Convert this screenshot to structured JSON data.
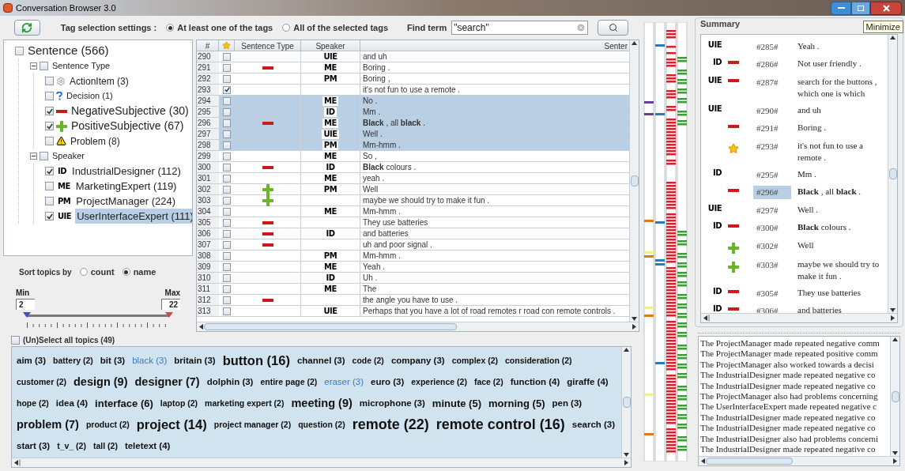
{
  "window": {
    "title": "Conversation Browser 3.0",
    "tooltip": "Minimize"
  },
  "toolbar": {
    "label": "Tag selection settings :",
    "options": [
      {
        "label": "At least one of the tags",
        "selected": true
      },
      {
        "label": "All of the selected tags",
        "selected": false
      }
    ],
    "find_label": "Find term",
    "find_value": "\"search\""
  },
  "tree": {
    "label": "Sentence (566)",
    "checked": false,
    "children": [
      {
        "label": "Sentence Type",
        "checked": false,
        "expanded": true,
        "kind": "none",
        "children": [
          {
            "label": "ActionItem (3)",
            "checked": false,
            "kind": "gear",
            "selected": false
          },
          {
            "label": "Decision (1)",
            "checked": false,
            "kind": "question",
            "selected": false
          },
          {
            "label": "NegativeSubjective (30)",
            "checked": true,
            "kind": "negative",
            "selected": false
          },
          {
            "label": "PositiveSubjective (67)",
            "checked": true,
            "kind": "positive",
            "selected": false
          },
          {
            "label": "Problem (8)",
            "checked": false,
            "kind": "warning",
            "selected": false
          }
        ]
      },
      {
        "label": "Speaker",
        "checked": false,
        "expanded": true,
        "kind": "none",
        "children": [
          {
            "label": "IndustrialDesigner (112)",
            "checked": true,
            "kind": "speaker",
            "code": "ID",
            "selected": false
          },
          {
            "label": "MarketingExpert (119)",
            "checked": false,
            "kind": "speaker",
            "code": "ME",
            "selected": false
          },
          {
            "label": "ProjectManager (224)",
            "checked": false,
            "kind": "speaker",
            "code": "PM",
            "selected": false
          },
          {
            "label": "UserInterfaceExpert (111)",
            "checked": true,
            "kind": "speaker",
            "code": "UIE",
            "selected": true
          }
        ]
      }
    ]
  },
  "sort": {
    "label": "Sort topics by",
    "options": [
      {
        "label": "count",
        "selected": false
      },
      {
        "label": "name",
        "selected": true
      }
    ]
  },
  "range": {
    "min_label": "Min",
    "max_label": "Max",
    "min_value": "2",
    "max_value": "22",
    "thumbs": [
      {
        "level": 0
      },
      {
        "level": 1
      }
    ]
  },
  "table": {
    "columns": [
      "#",
      "Sentence Type",
      "Speaker",
      "Senter"
    ],
    "rows": [
      {
        "number": "290",
        "starred": false,
        "kind": "none",
        "speaker": "UIE",
        "text": "and uh",
        "selected": false
      },
      {
        "number": "291",
        "starred": false,
        "kind": "negative",
        "speaker": "ME",
        "text": "Boring .",
        "selected": false
      },
      {
        "number": "292",
        "starred": false,
        "kind": "none",
        "speaker": "PM",
        "text": "Boring ,",
        "selected": false
      },
      {
        "number": "293",
        "starred": true,
        "kind": "none",
        "text": "it's not fun to use a remote .",
        "selected": false
      },
      {
        "number": "294",
        "starred": false,
        "kind": "none",
        "speaker": "ME",
        "text": "No .",
        "selected": true
      },
      {
        "number": "295",
        "starred": false,
        "kind": "none",
        "speaker": "ID",
        "text": "Mm .",
        "selected": true
      },
      {
        "number": "296",
        "starred": false,
        "kind": "negative",
        "speaker": "ME",
        "text": "**Black** , all **black** .",
        "selected": true
      },
      {
        "number": "297",
        "starred": false,
        "kind": "none",
        "speaker": "UIE",
        "text": "Well .",
        "selected": true
      },
      {
        "number": "298",
        "starred": false,
        "kind": "none",
        "speaker": "PM",
        "text": "Mm-hmm .",
        "selected": true
      },
      {
        "number": "299",
        "starred": false,
        "kind": "none",
        "speaker": "ME",
        "text": "So ,",
        "selected": false
      },
      {
        "number": "300",
        "starred": false,
        "kind": "negative",
        "speaker": "ID",
        "text": "**Black** colours .",
        "selected": false
      },
      {
        "number": "301",
        "starred": false,
        "kind": "none",
        "speaker": "ME",
        "text": "yeah .",
        "selected": false
      },
      {
        "number": "302",
        "starred": false,
        "kind": "positive",
        "speaker": "PM",
        "text": "Well",
        "selected": false
      },
      {
        "number": "303",
        "starred": false,
        "kind": "positive",
        "text": "maybe we should try to make it fun .",
        "selected": false
      },
      {
        "number": "304",
        "starred": false,
        "kind": "none",
        "speaker": "ME",
        "text": "Mm-hmm .",
        "selected": false
      },
      {
        "number": "305",
        "starred": false,
        "kind": "negative",
        "text": "They use batteries",
        "selected": false
      },
      {
        "number": "306",
        "starred": false,
        "kind": "negative",
        "speaker": "ID",
        "text": "and batteries",
        "selected": false
      },
      {
        "number": "307",
        "starred": false,
        "kind": "negative",
        "text": "uh and poor signal .",
        "selected": false
      },
      {
        "number": "308",
        "starred": false,
        "kind": "none",
        "speaker": "PM",
        "text": "Mm-hmm .",
        "selected": false
      },
      {
        "number": "309",
        "starred": false,
        "kind": "none",
        "speaker": "ME",
        "text": "Yeah .",
        "selected": false
      },
      {
        "number": "310",
        "starred": false,
        "kind": "none",
        "speaker": "ID",
        "text": "Uh .",
        "selected": false
      },
      {
        "number": "311",
        "starred": false,
        "kind": "none",
        "speaker": "ME",
        "text": "The",
        "selected": false
      },
      {
        "number": "312",
        "starred": false,
        "kind": "negative",
        "text": "the angle you have to use .",
        "selected": false
      },
      {
        "number": "313",
        "starred": false,
        "kind": "none",
        "speaker": "UIE",
        "text": "Perhaps that you have a lot of road remotes r road con remote controls .",
        "selected": false
      }
    ]
  },
  "topics": {
    "select_all": {
      "label": "(Un)Select all topics (49)",
      "checked": false
    },
    "items": [
      {
        "label": "aim (3)",
        "kind": "s",
        "selected": false
      },
      {
        "label": "battery (2)",
        "kind": "xs",
        "selected": false
      },
      {
        "label": "bit (3)",
        "kind": "s",
        "selected": false
      },
      {
        "label": "black (3)",
        "kind": "s",
        "selected": true
      },
      {
        "label": "britain (3)",
        "kind": "s",
        "selected": false
      },
      {
        "label": "button (16)",
        "kind": "xl",
        "selected": false
      },
      {
        "label": "channel (3)",
        "kind": "s",
        "selected": false
      },
      {
        "label": "code (2)",
        "kind": "xs",
        "selected": false
      },
      {
        "label": "company (3)",
        "kind": "s",
        "selected": false
      },
      {
        "label": "complex (2)",
        "kind": "xs",
        "selected": false
      },
      {
        "label": "consideration (2)",
        "kind": "xs",
        "selected": false
      },
      {
        "label": "customer (2)",
        "kind": "xs",
        "selected": false
      },
      {
        "label": "design (9)",
        "kind": "l",
        "selected": false
      },
      {
        "label": "designer (7)",
        "kind": "l",
        "selected": false
      },
      {
        "label": "dolphin (3)",
        "kind": "s",
        "selected": false
      },
      {
        "label": "entire page (2)",
        "kind": "xs",
        "selected": false
      },
      {
        "label": "eraser (3)",
        "kind": "s",
        "selected": true
      },
      {
        "label": "euro (3)",
        "kind": "s",
        "selected": false
      },
      {
        "label": "experience (2)",
        "kind": "xs",
        "selected": false
      },
      {
        "label": "face (2)",
        "kind": "xs",
        "selected": false
      },
      {
        "label": "function (4)",
        "kind": "s",
        "selected": false
      },
      {
        "label": "giraffe (4)",
        "kind": "s",
        "selected": false
      },
      {
        "label": "hope (2)",
        "kind": "xs",
        "selected": false
      },
      {
        "label": "idea (4)",
        "kind": "s",
        "selected": false
      },
      {
        "label": "interface (6)",
        "kind": "m",
        "selected": false
      },
      {
        "label": "laptop (2)",
        "kind": "xs",
        "selected": false
      },
      {
        "label": "marketing expert (2)",
        "kind": "xs",
        "selected": false
      },
      {
        "label": "meeting (9)",
        "kind": "l",
        "selected": false
      },
      {
        "label": "microphone (3)",
        "kind": "s",
        "selected": false
      },
      {
        "label": "minute (5)",
        "kind": "m",
        "selected": false
      },
      {
        "label": "morning (5)",
        "kind": "m",
        "selected": false
      },
      {
        "label": "pen (3)",
        "kind": "s",
        "selected": false
      },
      {
        "label": "problem (7)",
        "kind": "l",
        "selected": false
      },
      {
        "label": "product (2)",
        "kind": "xs",
        "selected": false
      },
      {
        "label": "project (14)",
        "kind": "xl",
        "selected": false
      },
      {
        "label": "project manager (2)",
        "kind": "xs",
        "selected": false
      },
      {
        "label": "question (2)",
        "kind": "xs",
        "selected": false
      },
      {
        "label": "remote (22)",
        "kind": "xxl",
        "selected": false
      },
      {
        "label": "remote control (16)",
        "kind": "xxl",
        "selected": false
      },
      {
        "label": "search (3)",
        "kind": "s",
        "selected": false
      },
      {
        "label": "start (3)",
        "kind": "s",
        "selected": false
      },
      {
        "label": "t_v_ (2)",
        "kind": "xs",
        "selected": false
      },
      {
        "label": "tall (2)",
        "kind": "xs",
        "selected": false
      },
      {
        "label": "teletext (4)",
        "kind": "s",
        "selected": false
      }
    ]
  },
  "summary": {
    "title": "Summary",
    "rows": [
      {
        "speaker": "UIE",
        "kind": "none",
        "number": "#285#",
        "text": "Yeah .",
        "selected": false
      },
      {
        "speaker": "ID",
        "kind": "negative",
        "number": "#286#",
        "text": "Not user friendly .",
        "selected": false
      },
      {
        "speaker": "UIE",
        "kind": "negative",
        "number": "#287#",
        "text": "search for the buttons , which one is which",
        "selected": false
      },
      {
        "speaker": "UIE",
        "kind": "none",
        "number": "#290#",
        "text": "and uh",
        "selected": false
      },
      {
        "kind": "negative",
        "number": "#291#",
        "text": "Boring .",
        "selected": false
      },
      {
        "kind": "starred",
        "number": "#293#",
        "text": "it's not fun to use a remote .",
        "selected": false
      },
      {
        "speaker": "ID",
        "kind": "none",
        "number": "#295#",
        "text": "Mm .",
        "selected": false
      },
      {
        "kind": "negative",
        "number": "#296#",
        "text": "**Black** , all **black** .",
        "selected": true
      },
      {
        "speaker": "UIE",
        "kind": "none",
        "number": "#297#",
        "text": "Well .",
        "selected": false
      },
      {
        "speaker": "ID",
        "kind": "negative",
        "number": "#300#",
        "text": "**Black** colours .",
        "selected": false
      },
      {
        "kind": "positive",
        "number": "#302#",
        "text": "Well",
        "selected": false
      },
      {
        "kind": "positive",
        "number": "#303#",
        "text": "maybe we should try to make it fun .",
        "selected": false
      },
      {
        "speaker": "ID",
        "kind": "negative",
        "number": "#305#",
        "text": "They use batteries",
        "selected": false
      },
      {
        "speaker": "ID",
        "kind": "negative",
        "number": "#306#",
        "text": "and batteries",
        "selected": false
      }
    ]
  },
  "messages": [
    "The ProjectManager made repeated negative comm",
    "The ProjectManager made repeated positive comm",
    "The ProjectManager also worked towards a decisi",
    "The IndustrialDesigner made repeated negative co",
    "The IndustrialDesigner made repeated negative co",
    "The ProjectManager also had problems concerning",
    "The UserInterfaceExpert made repeated negative c",
    "The IndustrialDesigner made repeated negative co",
    "The IndustrialDesigner made repeated negative co",
    "The IndustrialDesigner also had problems concerni",
    "The IndustrialDesigner made repeated negative co"
  ]
}
